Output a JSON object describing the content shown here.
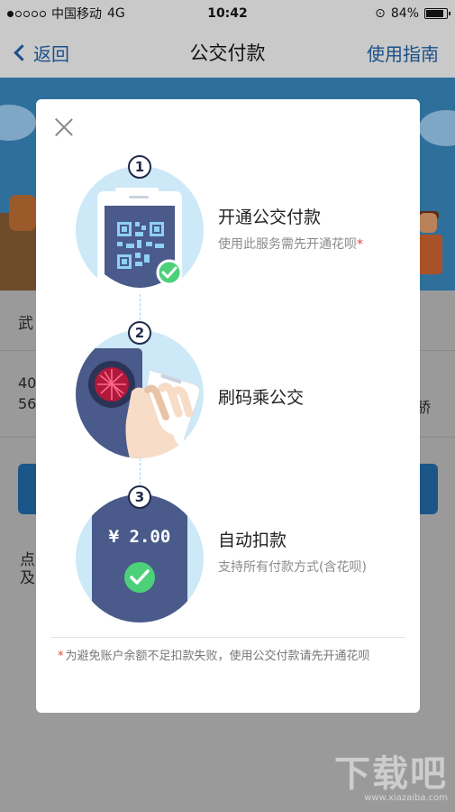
{
  "status_bar": {
    "carrier": "中国移动",
    "network": "4G",
    "time": "10:42",
    "battery": "84%"
  },
  "nav": {
    "back_label": "返回",
    "title": "公交付款",
    "guide_label": "使用指南"
  },
  "background": {
    "city_label": "武",
    "line1": "40",
    "line2": "56",
    "right_char": "骄",
    "para_char1": "点",
    "para_char2": "及"
  },
  "modal": {
    "steps": [
      {
        "number": "1",
        "title": "开通公交付款",
        "desc": "使用此服务需先开通花呗",
        "desc_mark": "*"
      },
      {
        "number": "2",
        "title": "刷码乘公交",
        "desc": "",
        "desc_mark": ""
      },
      {
        "number": "3",
        "title": "自动扣款",
        "desc": "支持所有付款方式(含花呗)",
        "desc_mark": "",
        "amount": "¥ 2.00"
      }
    ],
    "footnote_mark": "*",
    "footnote": "为避免账户余额不足扣款失败，使用公交付款请先开通花呗"
  },
  "watermark": {
    "brand": "下载吧",
    "url": "www.xiazaiba.com"
  },
  "colors": {
    "accent": "#1a4f8a",
    "illustration_bg": "#cde9f8",
    "phone_screen": "#4a5a8a",
    "check_green": "#4cd07a",
    "required_red": "#e2473a"
  }
}
